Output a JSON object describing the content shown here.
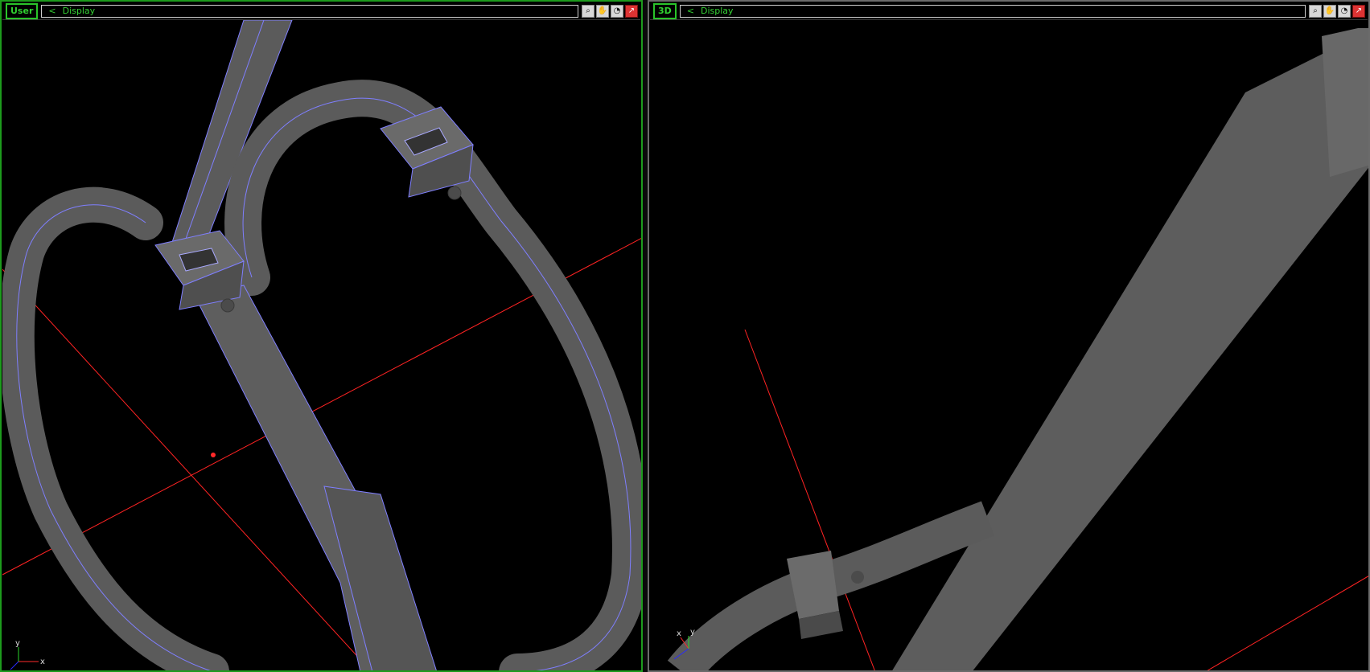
{
  "viewports": [
    {
      "label": "User",
      "display_label": "Display",
      "nav_chevron": "<",
      "tools": [
        "zoom-icon",
        "pan-icon",
        "orbit-icon",
        "maximize-icon"
      ]
    },
    {
      "label": "3D",
      "display_label": "Display",
      "nav_chevron": "<",
      "tools": [
        "zoom-icon",
        "pan-icon",
        "orbit-icon",
        "maximize-icon"
      ]
    }
  ],
  "axes": {
    "left": {
      "x": "x",
      "y": "y"
    },
    "right": {
      "x": "x",
      "y": "y"
    }
  },
  "colors": {
    "active_frame": "#1d9b1d",
    "label_green": "#31d131",
    "bg": "#000000",
    "mesh_gray": "#5a5a5a",
    "wire_blue": "#7f7fff",
    "axis_red": "#ff2a2a"
  }
}
